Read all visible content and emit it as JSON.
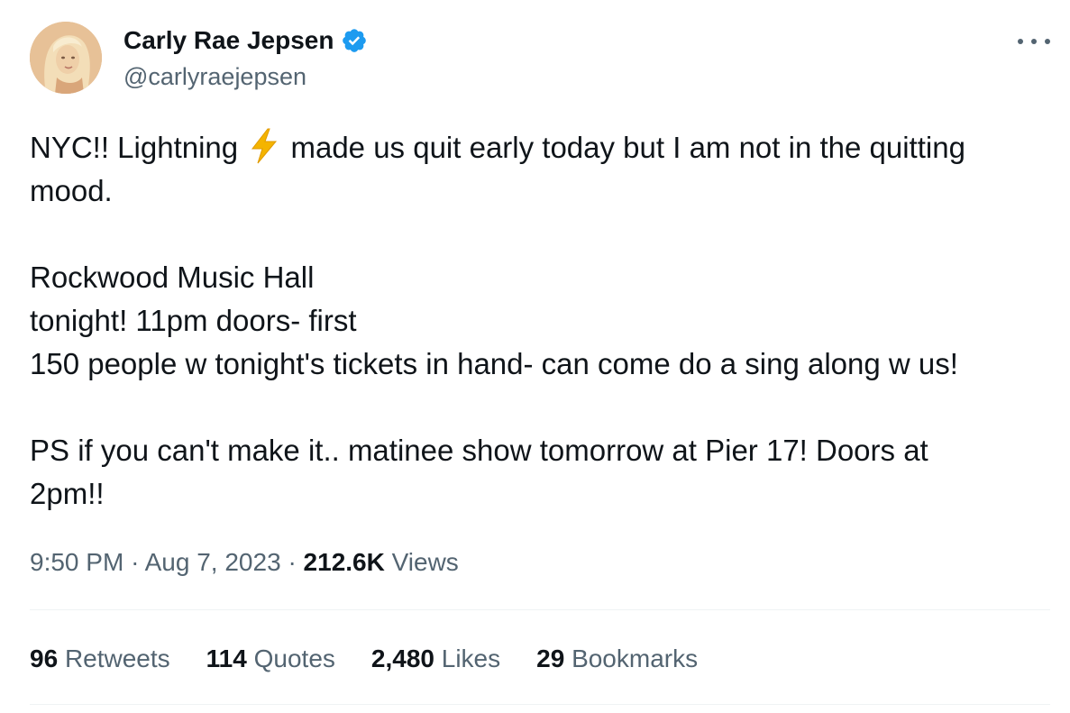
{
  "author": {
    "display_name": "Carly Rae Jepsen",
    "handle": "@carlyraejepsen",
    "verified": true,
    "avatar_icon": "profile-photo"
  },
  "colors": {
    "text": "#0f1419",
    "secondary": "#536471",
    "verified_blue": "#1d9bf0",
    "divider": "#eff3f4",
    "bolt": "#f4b400"
  },
  "tweet": {
    "line1_before": "NYC!! Lightning ",
    "line1_emoji": "lightning-bolt-icon",
    "line1_after": " made us quit early today but I am not in the quitting mood.",
    "para2_line1": "Rockwood Music Hall",
    "para2_line2": "tonight! 11pm doors- first",
    "para2_line3": "150 people w tonight's tickets in hand- can come do a sing along w us!",
    "para3": "PS if you can't make it.. matinee show tomorrow at Pier 17! Doors at 2pm!!"
  },
  "meta": {
    "time": "9:50 PM",
    "separator": "·",
    "date": "Aug 7, 2023",
    "views_count": "212.6K",
    "views_label": "Views"
  },
  "stats": [
    {
      "count": "96",
      "label": "Retweets"
    },
    {
      "count": "114",
      "label": "Quotes"
    },
    {
      "count": "2,480",
      "label": "Likes"
    },
    {
      "count": "29",
      "label": "Bookmarks"
    }
  ]
}
